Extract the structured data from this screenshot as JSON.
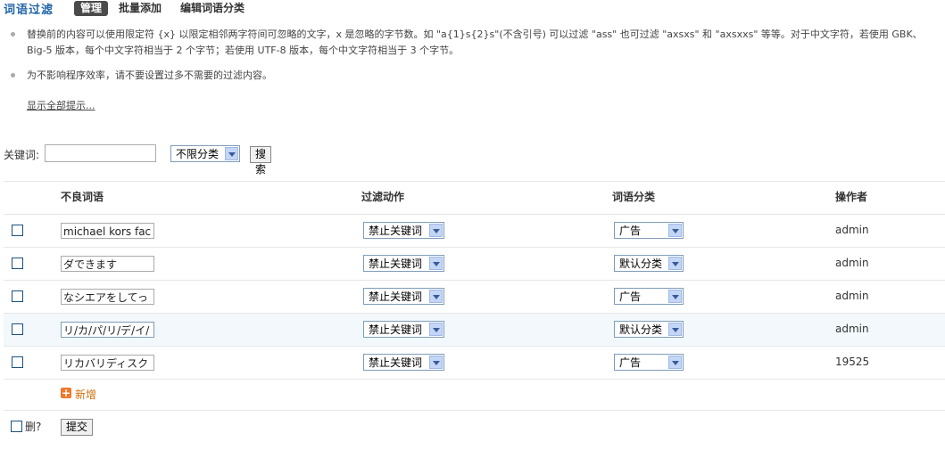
{
  "header": {
    "title": "词语过滤",
    "tabs": [
      {
        "label": "管理",
        "active": true
      },
      {
        "label": "批量添加"
      },
      {
        "label": "编辑词语分类"
      }
    ]
  },
  "tips": [
    "替换前的内容可以使用限定符 {x} 以限定相邻两字符间可忽略的文字，x 是忽略的字节数。如 \"a{1}s{2}s\"(不含引号) 可以过滤 \"ass\" 也可过滤 \"axsxs\" 和 \"axsxxs\" 等等。对于中文字符，若使用 GBK、Big-5 版本，每个中文字符相当于 2 个字节；若使用 UTF-8 版本，每个中文字符相当于 3 个字节。",
    "为不影响程序效率，请不要设置过多不需要的过滤内容。"
  ],
  "show_all": "显示全部提示...",
  "search": {
    "keyword_label": "关键词:",
    "keyword_value": "",
    "category": "不限分类",
    "button": "搜索"
  },
  "table": {
    "columns": [
      "不良词语",
      "过滤动作",
      "词语分类",
      "操作者"
    ],
    "rows": [
      {
        "word": "michael kors fac",
        "action": "禁止关键词",
        "category": "广告",
        "operator": "admin"
      },
      {
        "word": "ダできます",
        "action": "禁止关键词",
        "category": "默认分类",
        "operator": "admin"
      },
      {
        "word": "なシエアをしてっ",
        "action": "禁止关键词",
        "category": "广告",
        "operator": "admin"
      },
      {
        "word": "リ/カ/パ/リ/デ/イ/",
        "action": "禁止关键词",
        "category": "默认分类",
        "operator": "admin"
      },
      {
        "word": "リカバリディスク",
        "action": "禁止关键词",
        "category": "广告",
        "operator": "19525"
      }
    ],
    "add_label": "新增"
  },
  "footer": {
    "delete_label": "删?",
    "submit": "提交"
  },
  "colors": {
    "title": "#2366a8",
    "add": "#d36d0d",
    "highlight_row": "#f2f8fb"
  }
}
